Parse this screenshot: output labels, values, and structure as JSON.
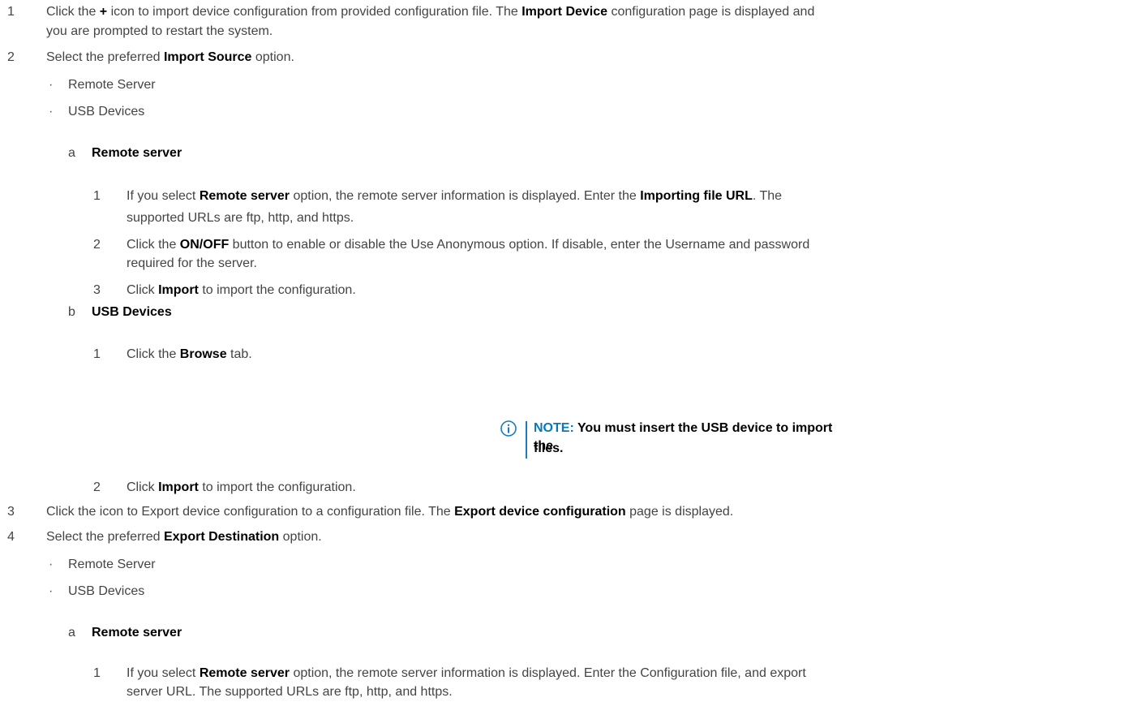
{
  "steps": {
    "s1": {
      "num": "1",
      "line1": {
        "t1": "Click the ",
        "plus": "+",
        "t2": " icon to import device configuration from provided configuration file. The ",
        "b1": "Import Device",
        "t3": " configuration page is displayed and"
      },
      "line2": "you are prompted to restart the system."
    },
    "s2": {
      "num": "2",
      "t1": "Select the preferred ",
      "b1": "Import Source",
      "t2": " option."
    },
    "s2_bullets": [
      "Remote Server",
      "USB Devices"
    ],
    "s2a": {
      "letter": "a",
      "title": "Remote server"
    },
    "s2a1": {
      "num": "1",
      "line1": {
        "t1": "If you select ",
        "b1": "Remote server",
        "t2": " option, the remote server information is displayed. Enter the ",
        "b2": "Importing file URL",
        "t3": ". The"
      },
      "line2": "supported URLs are ftp, http, and https."
    },
    "s2a2": {
      "num": "2",
      "line1": {
        "t1": "Click the ",
        "b1": "ON/OFF",
        "t2": " button to enable or disable the Use Anonymous option. If disable, enter the Username and password"
      },
      "line2": "required for the server."
    },
    "s2a3": {
      "num": "3",
      "t1": "Click ",
      "b1": "Import",
      "t2": " to import the configuration."
    },
    "s2b": {
      "letter": "b",
      "title": "USB Devices"
    },
    "s2b1": {
      "num": "1",
      "t1": "Click the ",
      "b1": "Browse",
      "t2": " tab."
    },
    "note": {
      "label": "NOTE:",
      "line1": " You must insert the USB device to import the",
      "line2": "files."
    },
    "s2b2": {
      "num": "2",
      "t1": "Click ",
      "b1": "Import",
      "t2": " to import the configuration."
    },
    "s3": {
      "num": "3",
      "t1": "Click the icon to Export device configuration to a configuration file. The ",
      "b1": "Export device configuration",
      "t2": " page is displayed."
    },
    "s4": {
      "num": "4",
      "t1": "Select the preferred ",
      "b1": "Export Destination",
      "t2": " option."
    },
    "s4_bullets": [
      "Remote Server",
      "USB Devices"
    ],
    "s4a": {
      "letter": "a",
      "title": "Remote server"
    },
    "s4a1": {
      "num": "1",
      "line1": {
        "t1": "If you select ",
        "b1": "Remote server",
        "t2": " option, the remote server information is displayed. Enter the Configuration file, and export"
      },
      "line2": "server URL. The supported URLs are ftp, http, and https."
    }
  },
  "icons": {
    "note": "info-circle-icon"
  },
  "colors": {
    "note_accent": "#0a78b7",
    "body_text": "#444444",
    "bold_text": "#000000"
  }
}
